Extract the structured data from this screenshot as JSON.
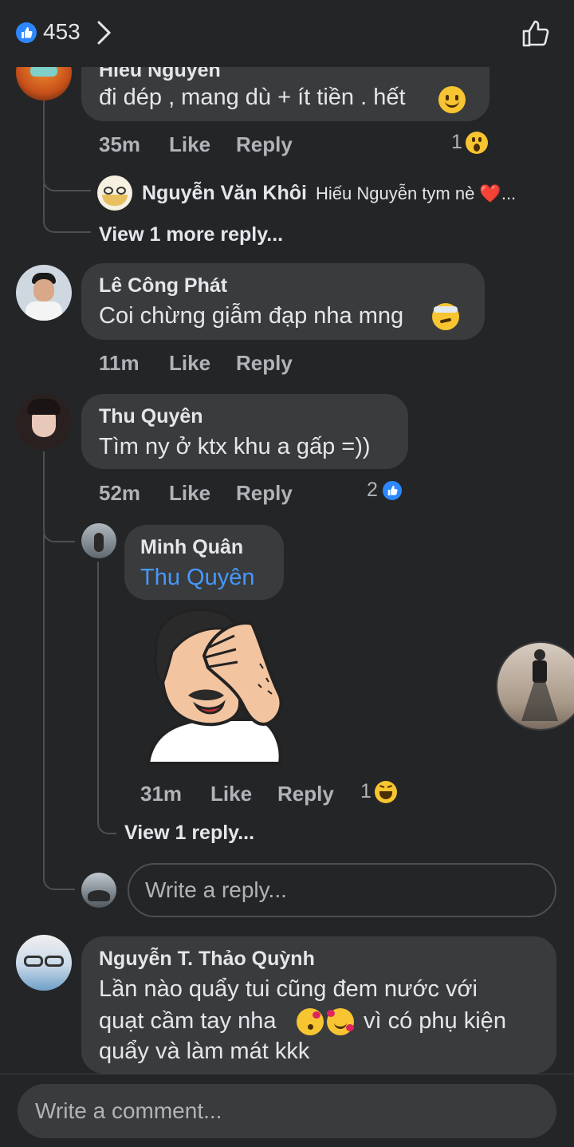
{
  "header": {
    "like_count": "453"
  },
  "comments": {
    "c0": {
      "author": "Hiếu Nguyễn",
      "text": "đi dép , mang dù + ít tiền . hết",
      "time": "35m",
      "like": "Like",
      "reply": "Reply",
      "reaction_count": "1"
    },
    "c0_reply": {
      "author": "Nguyễn Văn Khôi",
      "text": "Hiếu Nguyễn tym nè ❤️...",
      "view_more": "View 1 more reply..."
    },
    "c1": {
      "author": "Lê Công Phát",
      "text": "Coi chừng giẫm đạp nha mng",
      "time": "11m",
      "like": "Like",
      "reply": "Reply"
    },
    "c2": {
      "author": "Thu Quyên",
      "text": "Tìm ny ở ktx khu a gấp =))",
      "time": "52m",
      "like": "Like",
      "reply": "Reply",
      "reaction_count": "2"
    },
    "c2_reply": {
      "author": "Minh Quân",
      "mention": "Thu Quyên",
      "time": "31m",
      "like": "Like",
      "reply": "Reply",
      "reaction_count": "1",
      "view_more": "View 1 reply..."
    },
    "reply_box": {
      "placeholder": "Write a reply..."
    },
    "c3": {
      "author": "Nguyễn T. Thảo Quỳnh",
      "line1": "Lần nào quẩy tui cũng đem nước với",
      "line2a": "quạt cầm tay nha",
      "line2b": "vì có phụ kiện",
      "line3": "quẩy và làm mát kkk"
    }
  },
  "footer": {
    "placeholder": "Write a comment..."
  },
  "colors": {
    "background": "#242526",
    "bubble": "#3a3b3c",
    "accent": "#2d88ff",
    "link": "#4599ff"
  }
}
